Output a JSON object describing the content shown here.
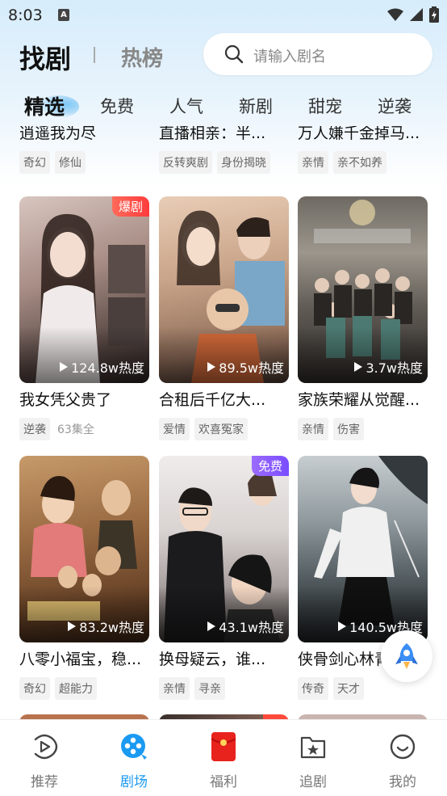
{
  "status_bar": {
    "time": "8:03",
    "notif_glyph": "A"
  },
  "header": {
    "title": "找剧",
    "secondary": "热榜",
    "search_placeholder": "请输入剧名"
  },
  "tabs": [
    {
      "label": "精选",
      "active": true
    },
    {
      "label": "免费"
    },
    {
      "label": "人气"
    },
    {
      "label": "新剧"
    },
    {
      "label": "甜宠"
    },
    {
      "label": "逆袭"
    }
  ],
  "partial_row": [
    {
      "title": "逍遥我为尽",
      "tags": [
        "奇幻",
        "修仙"
      ]
    },
    {
      "title": "直播相亲：半...",
      "tags": [
        "反转爽剧",
        "身份揭晓"
      ]
    },
    {
      "title": "万人嫌千金掉马...",
      "tags": [
        "亲情",
        "亲不如养"
      ]
    }
  ],
  "cards": [
    {
      "title": "我女凭父贵了",
      "views": "124.8w热度",
      "badge": "爆剧",
      "badge_color": "#ff4a3b",
      "tags": [
        "逆袭"
      ],
      "episodes": "63集全"
    },
    {
      "title": "合租后千亿大...",
      "views": "89.5w热度",
      "tags": [
        "爱情",
        "欢喜冤家"
      ]
    },
    {
      "title": "家族荣耀从觉醒...",
      "views": "3.7w热度",
      "tags": [
        "亲情",
        "伤害"
      ]
    },
    {
      "title": "八零小福宝，稳...",
      "views": "83.2w热度",
      "tags": [
        "奇幻",
        "超能力"
      ]
    },
    {
      "title": "换母疑云，谁...",
      "views": "43.1w热度",
      "badge": "免费",
      "badge_color": "#8a5cff",
      "tags": [
        "亲情",
        "寻亲"
      ]
    },
    {
      "title": "侠骨剑心林青宝",
      "views": "140.5w热度",
      "tags": [
        "传奇",
        "天才"
      ]
    }
  ],
  "bottom_nav": [
    {
      "label": "推荐",
      "icon": "play-circle-icon"
    },
    {
      "label": "剧场",
      "icon": "theater-icon",
      "active": true
    },
    {
      "label": "福利",
      "icon": "red-envelope-icon"
    },
    {
      "label": "追剧",
      "icon": "star-folder-icon"
    },
    {
      "label": "我的",
      "icon": "smile-face-icon"
    }
  ],
  "colors": {
    "accent": "#1b9af2",
    "badge_red": "#ff4a3b",
    "badge_purple": "#8a5cff"
  }
}
